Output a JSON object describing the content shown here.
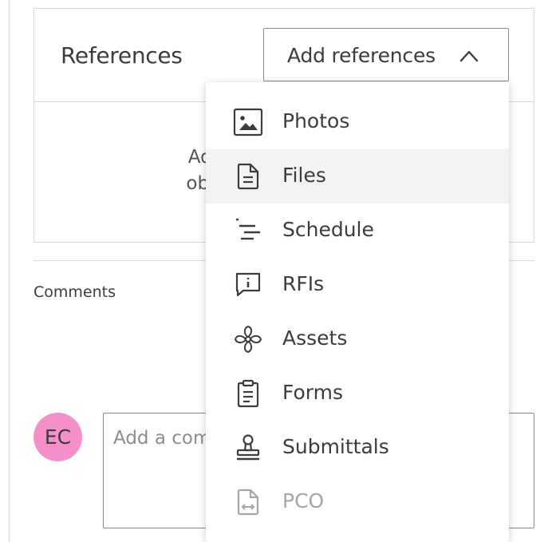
{
  "references": {
    "title": "References",
    "add_button_label": "Add references",
    "empty_line1": "Add",
    "empty_line2": "obje"
  },
  "comments": {
    "label": "Comments",
    "avatar_initials": "EC",
    "avatar_color": "#f58fc7",
    "placeholder": "Add a com"
  },
  "menu": {
    "items": [
      {
        "label": "Photos",
        "icon": "image-icon",
        "state": "normal"
      },
      {
        "label": "Files",
        "icon": "file-icon",
        "state": "hovered"
      },
      {
        "label": "Schedule",
        "icon": "schedule-icon",
        "state": "normal"
      },
      {
        "label": "RFIs",
        "icon": "rfi-icon",
        "state": "normal"
      },
      {
        "label": "Assets",
        "icon": "assets-icon",
        "state": "normal"
      },
      {
        "label": "Forms",
        "icon": "clipboard-icon",
        "state": "normal"
      },
      {
        "label": "Submittals",
        "icon": "stamp-icon",
        "state": "normal"
      },
      {
        "label": "PCO",
        "icon": "pco-icon",
        "state": "disabled"
      }
    ]
  },
  "colors": {
    "border": "#d9d9d9",
    "text": "#3c3c3c",
    "hover": "#f3f3f3",
    "disabled": "#a6a6a6"
  }
}
